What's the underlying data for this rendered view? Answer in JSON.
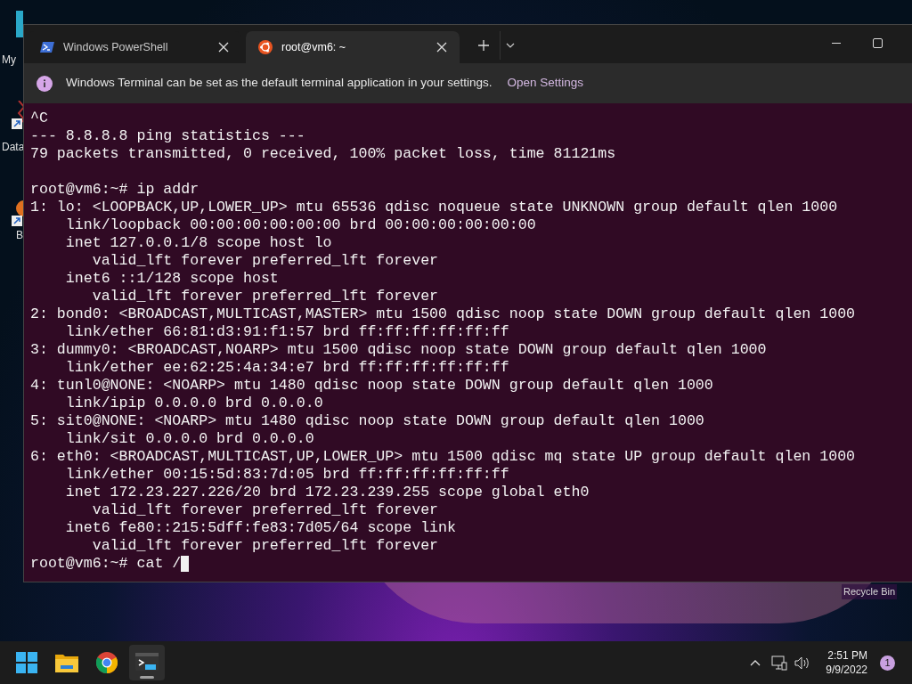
{
  "desktop_icons": [
    {
      "label": "My",
      "kind": "monitor"
    },
    {
      "label": "Data",
      "kind": "shortcut"
    },
    {
      "label": "B",
      "kind": "shortcut2"
    }
  ],
  "recycle_bin": {
    "label": "Recycle Bin"
  },
  "window": {
    "tabs": [
      {
        "title": "Windows PowerShell",
        "kind": "powershell",
        "selected": false
      },
      {
        "title": "root@vm6: ~",
        "kind": "ubuntu",
        "selected": true
      }
    ],
    "infobar": {
      "message": "Windows Terminal can be set as the default terminal application in your settings.",
      "link": "Open Settings"
    },
    "terminal": {
      "lines": [
        {
          "text": "^C"
        },
        {
          "text": "--- 8.8.8.8 ping statistics ---"
        },
        {
          "text": "79 packets transmitted, 0 received, 100% packet loss, time 81121ms"
        },
        {
          "text": "root@vm6:~# ip addr",
          "gap_before": true
        },
        {
          "text": "1: lo: <LOOPBACK,UP,LOWER_UP> mtu 65536 qdisc noqueue state UNKNOWN group default qlen 1000"
        },
        {
          "text": "    link/loopback 00:00:00:00:00:00 brd 00:00:00:00:00:00"
        },
        {
          "text": "    inet 127.0.0.1/8 scope host lo"
        },
        {
          "text": "       valid_lft forever preferred_lft forever"
        },
        {
          "text": "    inet6 ::1/128 scope host"
        },
        {
          "text": "       valid_lft forever preferred_lft forever"
        },
        {
          "text": "2: bond0: <BROADCAST,MULTICAST,MASTER> mtu 1500 qdisc noop state DOWN group default qlen 1000"
        },
        {
          "text": "    link/ether 66:81:d3:91:f1:57 brd ff:ff:ff:ff:ff:ff"
        },
        {
          "text": "3: dummy0: <BROADCAST,NOARP> mtu 1500 qdisc noop state DOWN group default qlen 1000"
        },
        {
          "text": "    link/ether ee:62:25:4a:34:e7 brd ff:ff:ff:ff:ff:ff"
        },
        {
          "text": "4: tunl0@NONE: <NOARP> mtu 1480 qdisc noop state DOWN group default qlen 1000"
        },
        {
          "text": "    link/ipip 0.0.0.0 brd 0.0.0.0"
        },
        {
          "text": "5: sit0@NONE: <NOARP> mtu 1480 qdisc noop state DOWN group default qlen 1000"
        },
        {
          "text": "    link/sit 0.0.0.0 brd 0.0.0.0"
        },
        {
          "text": "6: eth0: <BROADCAST,MULTICAST,UP,LOWER_UP> mtu 1500 qdisc mq state UP group default qlen 1000"
        },
        {
          "text": "    link/ether 00:15:5d:83:7d:05 brd ff:ff:ff:ff:ff:ff"
        },
        {
          "text": "    inet 172.23.227.226/20 brd 172.23.239.255 scope global eth0"
        },
        {
          "text": "       valid_lft forever preferred_lft forever"
        },
        {
          "text": "    inet6 fe80::215:5dff:fe83:7d05/64 scope link"
        },
        {
          "text": "       valid_lft forever preferred_lft forever"
        }
      ],
      "input": {
        "text": "root@vm6:~# cat /",
        "cursor": true
      }
    }
  },
  "taskbar": {
    "apps": [
      {
        "kind": "start",
        "selected": false
      },
      {
        "kind": "explorer",
        "selected": false
      },
      {
        "kind": "chrome",
        "selected": false
      },
      {
        "kind": "terminal",
        "selected": true
      }
    ],
    "time": "2:51 PM",
    "date": "9/9/2022",
    "notifications": "1"
  }
}
